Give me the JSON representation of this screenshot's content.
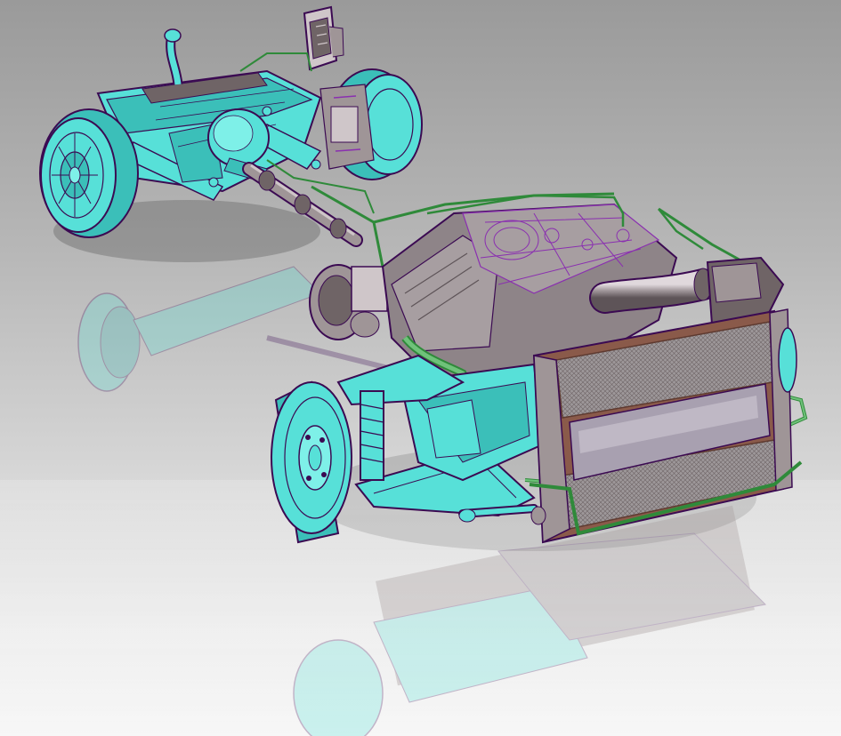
{
  "viewport": {
    "background_top": "#9a9a9a",
    "background_bottom": "#f7f7f7"
  },
  "colors": {
    "body_fill": "#57e0d8",
    "body_shade": "#3bbfb9",
    "outline": "#3b0a52",
    "wire_purple": "#8a2fb0",
    "pipe_green": "#2f8a3a",
    "metal_light": "#cfc6c9",
    "metal_mid": "#9f9597",
    "metal_dark": "#6f6466",
    "radiator_frame": "#8a5a4a",
    "radiator_core": "#a09a9c"
  },
  "scene": {
    "model": "chassis-assembly",
    "components": [
      "rear-axle",
      "rear-wheel-left",
      "rear-wheel-right",
      "differential",
      "drive-shaft",
      "engine-block",
      "intake-pipe",
      "air-filter-box",
      "radiator",
      "front-wheel-brake-disc",
      "front-suspension",
      "control-module",
      "reflection"
    ]
  }
}
